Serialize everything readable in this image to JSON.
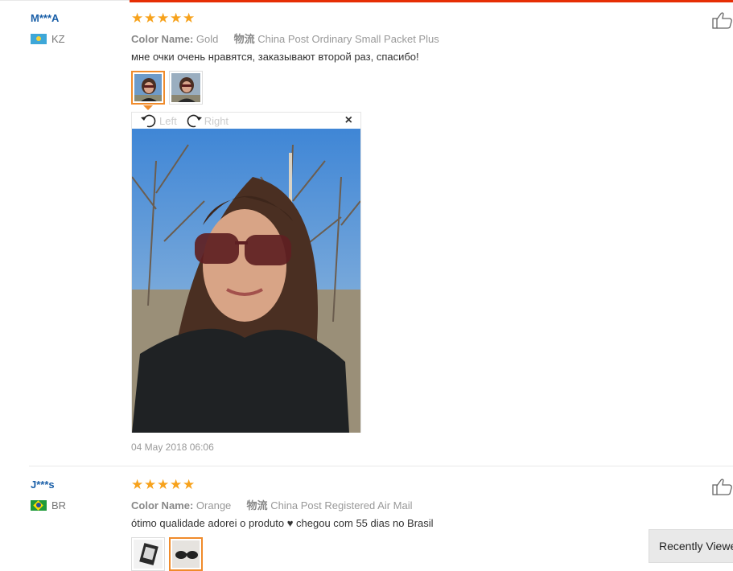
{
  "reviews": [
    {
      "user": "M***A",
      "country": "KZ",
      "rating": 5,
      "color_label": "Color Name:",
      "color_value": "Gold",
      "shipping_label": "物流",
      "shipping_value": "China Post Ordinary Small Packet Plus",
      "text": "мне очки очень нравятся, заказывают второй раз, спасибо!",
      "viewer": {
        "rotate_left": "Left",
        "rotate_right": "Right",
        "close": "×"
      },
      "date": "04 May 2018 06:06"
    },
    {
      "user": "J***s",
      "country": "BR",
      "rating": 5,
      "color_label": "Color Name:",
      "color_value": "Orange",
      "shipping_label": "物流",
      "shipping_value": "China Post Registered Air Mail",
      "text": "ótimo qualidade adorei o produto ♥ chegou com 55 dias no Brasil"
    }
  ],
  "recently_viewed": "Recently Viewed",
  "colors": {
    "accent": "#e62e04",
    "star": "#f7a21c",
    "username": "#1a5fa8",
    "thumb_active": "#f08b2b"
  },
  "icons": {
    "like": "thumbs-up-icon",
    "rotate_left": "rotate-left-icon",
    "rotate_right": "rotate-right-icon",
    "close": "close-icon",
    "star": "star-icon"
  }
}
